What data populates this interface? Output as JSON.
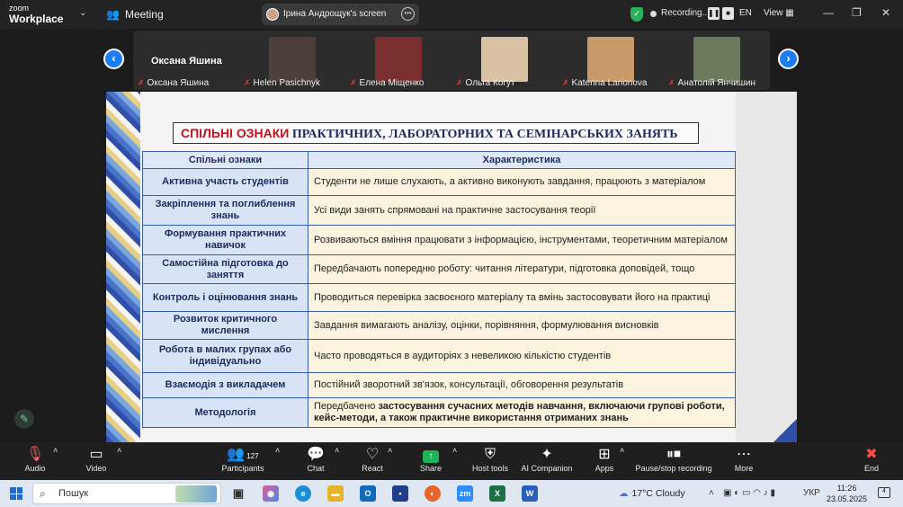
{
  "app": {
    "logo_line1": "zoom",
    "logo_line2": "Workplace",
    "meeting_label": "Meeting"
  },
  "screen_share": {
    "label": "Ірина  Андрощук's screen"
  },
  "recording": {
    "label": "Recording...",
    "pause": "❚❚",
    "stop": "■"
  },
  "topbar": {
    "language": "EN",
    "view_label": "View",
    "minimize": "—",
    "restore": "❐",
    "close": "✕"
  },
  "strip": {
    "active_speaker": "Оксана Яшина",
    "participants": [
      {
        "name": "Оксана Яшина",
        "color": "#2c2c2c"
      },
      {
        "name": "Helen Pasichnyk",
        "color": "#5a4a44"
      },
      {
        "name": "Елена Міщенко",
        "color": "#7a2e2e"
      },
      {
        "name": "Ольга Когут",
        "color": "#d9c2a4"
      },
      {
        "name": "Katerina Larionova",
        "color": "#c89a6a"
      },
      {
        "name": "Анатолій Янчишин",
        "color": "#6a7a5a"
      }
    ]
  },
  "slide": {
    "title_red": "СПІЛЬНІ ОЗНАКИ",
    "title_rest": " ПРАКТИЧНИХ, ЛАБОРАТОРНИХ ТА СЕМІНАРСЬКИХ ЗАНЯТЬ",
    "headers": [
      "Спільні ознаки",
      "Характеристика"
    ],
    "rows": [
      {
        "k": "Активна участь студентів",
        "v": "Студенти не лише слухають, а активно виконують завдання, працюють з матеріалом"
      },
      {
        "k": "Закріплення та поглиблення знань",
        "v": "Усі види занять спрямовані на практичне застосування теорії"
      },
      {
        "k": "Формування практичних навичок",
        "v": "Розвиваються вміння працювати з інформацією, інструментами, теоретичним матеріалом"
      },
      {
        "k": "Самостійна підготовка до заняття",
        "v": "Передбачають попередню роботу: читання літератури, підготовка доповідей, тощо"
      },
      {
        "k": "Контроль і оцінювання знань",
        "v": "Проводиться перевірка засвоєного матеріалу та вмінь застосовувати його на практиці"
      },
      {
        "k": "Розвиток критичного мислення",
        "v": "Завдання вимагають аналізу, оцінки, порівняння, формулювання висновків"
      },
      {
        "k": "Робота в малих групах або індивідуально",
        "v": "Часто проводяться в аудиторіях з невеликою кількістю студентів"
      },
      {
        "k": "Взаємодія з викладачем",
        "v": "Постійний зворотний зв'язок, консультації, обговорення результатів"
      }
    ],
    "last_row": {
      "k": "Методологія",
      "v_plain": "Передбачено ",
      "v_bold": "застосування сучасних методів навчання, включаючи групові роботи, кейс-методи, а також практичне використання отриманих знань"
    }
  },
  "toolbar": {
    "audio": "Audio",
    "video": "Video",
    "participants": "Participants",
    "participants_count": "127",
    "chat": "Chat",
    "react": "React",
    "share": "Share",
    "host_tools": "Host tools",
    "ai_companion": "AI Companion",
    "apps": "Apps",
    "pause_stop": "Pause/stop recording",
    "more": "More",
    "end": "End"
  },
  "taskbar": {
    "search_label": "Пошук",
    "weather": "17°C  Cloudy",
    "lang": "УКР",
    "time": "11:26",
    "date": "23.05.2025",
    "notif_count": "4"
  }
}
